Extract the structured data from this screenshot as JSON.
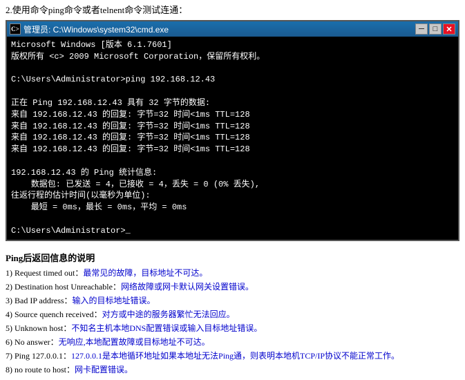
{
  "instruction": {
    "text": "2.使用命令ping命令或者telnent命令测试连通："
  },
  "cmd_window": {
    "title": "管理员: C:\\Windows\\system32\\cmd.exe",
    "icon_char": "C:",
    "lines": [
      "Microsoft Windows [版本 6.1.7601]",
      "版权所有 <c> 2009 Microsoft Corporation。保留所有权利。",
      "",
      "C:\\Users\\Administrator>ping 192.168.12.43",
      "",
      "正在 Ping 192.168.12.43 具有 32 字节的数据:",
      "来自 192.168.12.43 的回复: 字节=32 时间<1ms TTL=128",
      "来自 192.168.12.43 的回复: 字节=32 时间<1ms TTL=128",
      "来自 192.168.12.43 的回复: 字节=32 时间<1ms TTL=128",
      "来自 192.168.12.43 的回复: 字节=32 时间<1ms TTL=128",
      "",
      "192.168.12.43 的 Ping 统计信息:",
      "    数据包: 已发送 = 4，已接收 = 4，丢失 = 0 (0% 丢失),",
      "往返行程的估计时间(以毫秒为单位):",
      "    最短 = 0ms，最长 = 0ms，平均 = 0ms",
      "",
      "C:\\Users\\Administrator>_"
    ],
    "buttons": {
      "min": "─",
      "max": "□",
      "close": "✕"
    }
  },
  "ping_section": {
    "title": "Ping后返回信息的说明",
    "items": [
      {
        "num": "1)",
        "label": "Request timed out：",
        "desc": "最常见的故障，目标地址不可达。"
      },
      {
        "num": "2)",
        "label": "Destination host Unreachable：",
        "desc": "网络故障或网卡默认网关设置错误。"
      },
      {
        "num": "3)",
        "label": "Bad IP address：",
        "desc": "输入的目标地址错误。"
      },
      {
        "num": "4)",
        "label": "Source quench received：",
        "desc": "对方或中途的服务器繁忙无法回应。"
      },
      {
        "num": "5)",
        "label": "Unknown host：",
        "desc": "不知名主机本地DNS配置错误或输入目标地址错误。"
      },
      {
        "num": "6)",
        "label": "No answer：",
        "desc": "无响应,本地配置故障或目标地址不可达。"
      },
      {
        "num": "7)",
        "label": "Ping 127.0.0.1：",
        "desc": "127.0.0.1是本地循环地址如果本地址无法Ping通，则表明本地机TCP/IP协议不能正常工作。"
      },
      {
        "num": "8)",
        "label": "no route to host：",
        "desc": "网卡配置错误。"
      }
    ]
  }
}
